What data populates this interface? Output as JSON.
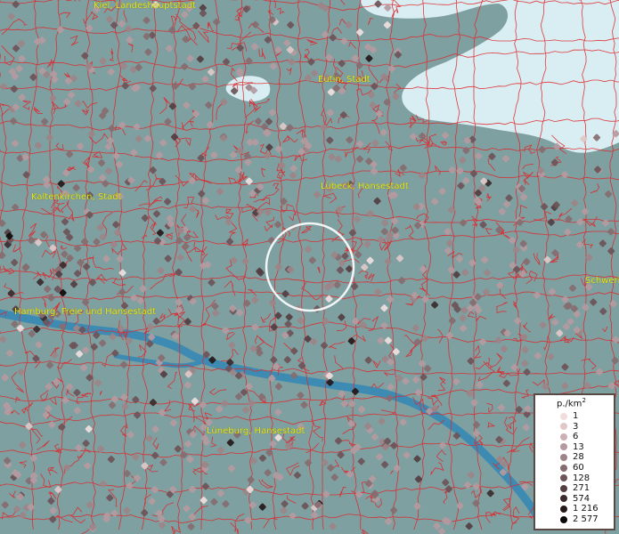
{
  "map": {
    "places": [
      {
        "name": "Kiel, Landeshauptstadt",
        "lon": 10.13,
        "lat": 54.32
      },
      {
        "name": "Eutin, Stadt",
        "lon": 10.62,
        "lat": 54.14
      },
      {
        "name": "Lübeck, Hansestadt",
        "lon": 10.69,
        "lat": 53.87
      },
      {
        "name": "Kaltenkirchen, Stadt",
        "lon": 9.96,
        "lat": 53.84
      },
      {
        "name": "Hamburg, Freie und Hansestadt",
        "lon": 10.0,
        "lat": 53.55
      },
      {
        "name": "Lüneburg, Hansestadt",
        "lon": 10.41,
        "lat": 53.25
      },
      {
        "name": "Schwerin",
        "lon": 11.42,
        "lat": 53.63
      }
    ],
    "colors": {
      "land": "#7fa0a0",
      "sea": "#d8eef2",
      "river": "#3d8bb3",
      "boundaries": "#e0252a",
      "label": "#e6e619",
      "focus_ring": "#ffffff"
    }
  },
  "legend": {
    "title": "p./km",
    "title_sup": "2",
    "items": [
      {
        "label": "1",
        "color": "#f0dede"
      },
      {
        "label": "3",
        "color": "#e0c8c8"
      },
      {
        "label": "6",
        "color": "#ccb0b4"
      },
      {
        "label": "13",
        "color": "#b49aa0"
      },
      {
        "label": "28",
        "color": "#9c8488"
      },
      {
        "label": "60",
        "color": "#856c70"
      },
      {
        "label": "128",
        "color": "#6c5458"
      },
      {
        "label": "271",
        "color": "#533e42"
      },
      {
        "label": "574",
        "color": "#3a2a2c"
      },
      {
        "label": "1 216",
        "color": "#241819"
      },
      {
        "label": "2 577",
        "color": "#0e0909"
      }
    ]
  }
}
